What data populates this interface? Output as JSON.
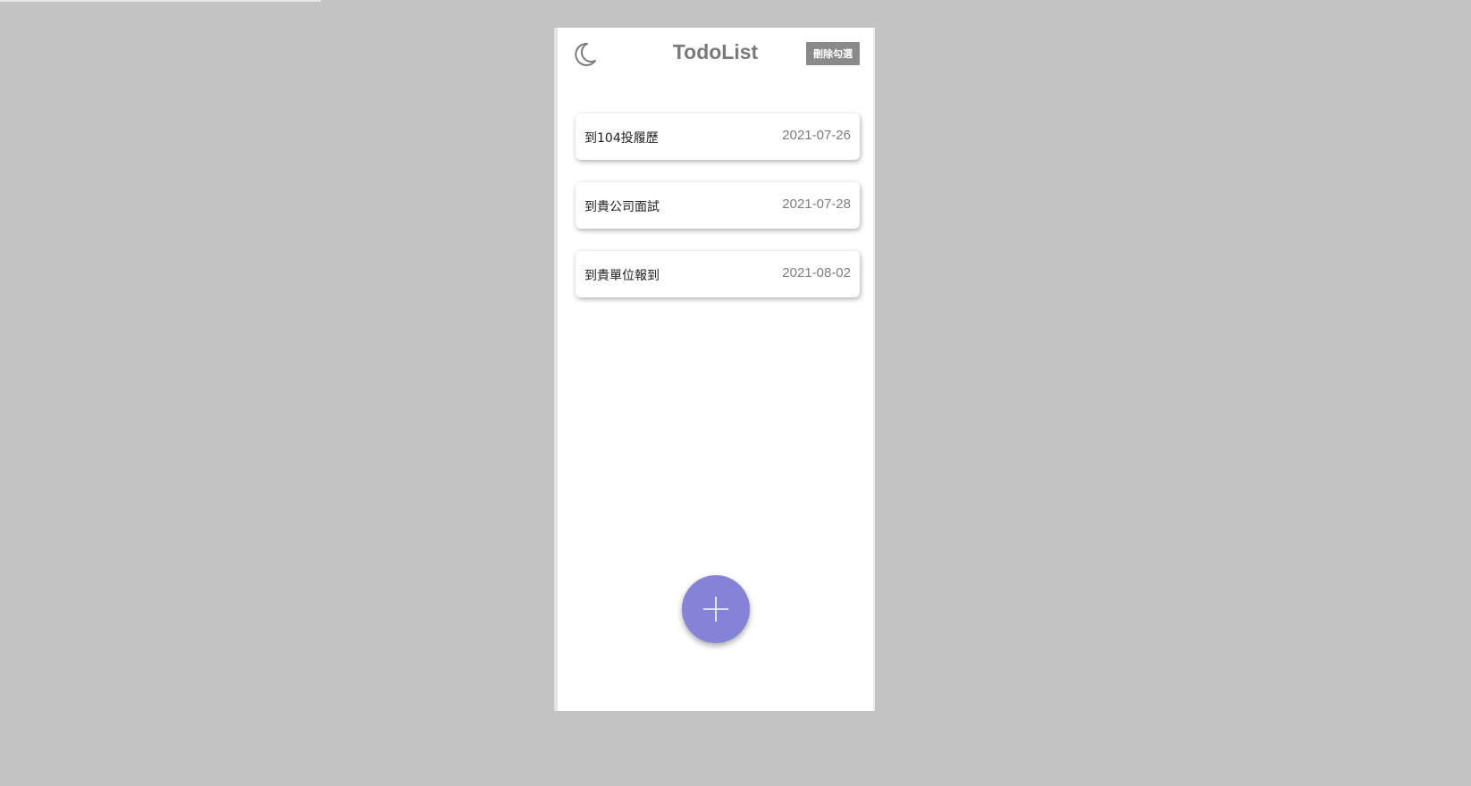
{
  "header": {
    "title": "TodoList",
    "delete_checked_label": "刪除勾選",
    "theme_icon": "moon-icon"
  },
  "todos": [
    {
      "text": "到104投履歷",
      "date": "2021-07-26"
    },
    {
      "text": "到貴公司面試",
      "date": "2021-07-28"
    },
    {
      "text": "到貴單位報到",
      "date": "2021-08-02"
    }
  ],
  "fab": {
    "icon": "plus-icon"
  },
  "colors": {
    "background": "#c3c3c3",
    "card": "#ffffff",
    "title": "#7a7a7a",
    "delete_button": "#8a8a8a",
    "date_text": "#7d7d7d",
    "fab": "#8483d7"
  }
}
